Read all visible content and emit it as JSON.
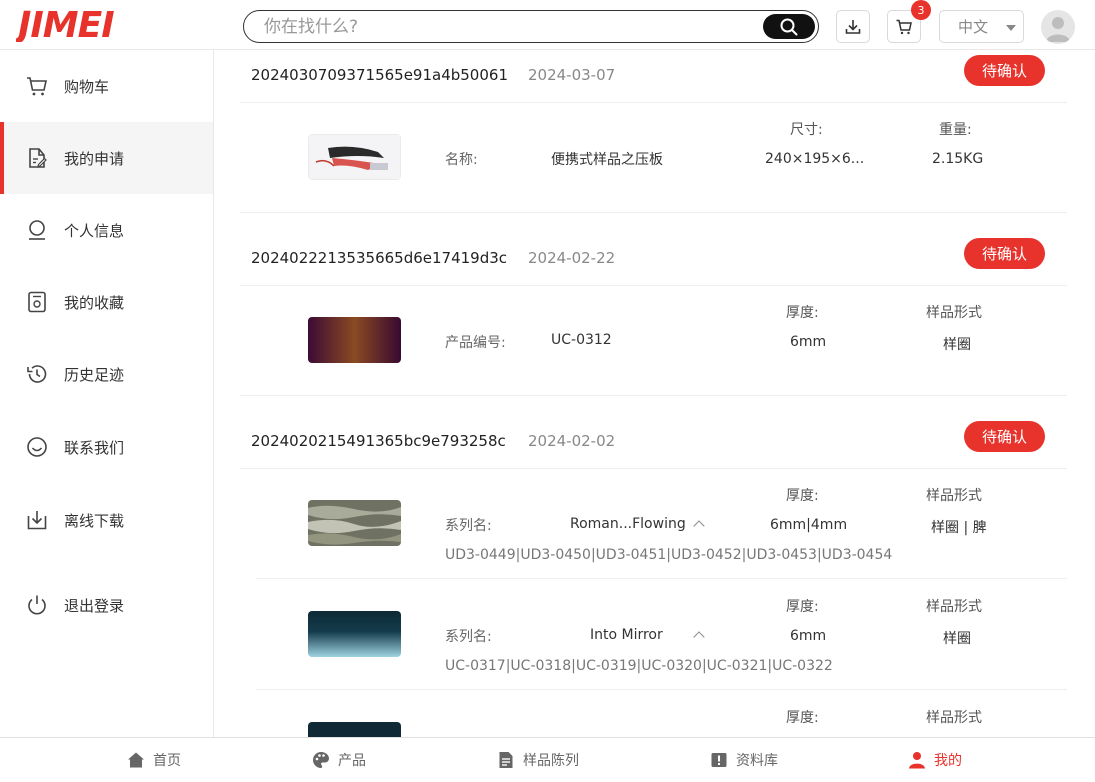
{
  "header": {
    "logo_text": "JIMEI",
    "search_placeholder": "你在找什么?",
    "cart_badge": "3",
    "language": "中文"
  },
  "sidebar": {
    "items": [
      {
        "label": "购物车",
        "icon": "cart-icon"
      },
      {
        "label": "我的申请",
        "icon": "edit-document-icon",
        "active": true
      },
      {
        "label": "个人信息",
        "icon": "user-icon"
      },
      {
        "label": "我的收藏",
        "icon": "favorite-icon"
      },
      {
        "label": "历史足迹",
        "icon": "history-icon"
      },
      {
        "label": "联系我们",
        "icon": "smile-icon"
      },
      {
        "label": "离线下载",
        "icon": "download-icon"
      },
      {
        "label": "退出登录",
        "icon": "power-icon"
      }
    ]
  },
  "orders": [
    {
      "id": "2024030709371565e91a4b50061",
      "date": "2024-03-07",
      "status": "待确认",
      "item": {
        "name_label": "名称:",
        "name_value": "便携式样品之压板",
        "size_label": "尺寸:",
        "size_value": "240×195×6...",
        "weight_label": "重量:",
        "weight_value": "2.15KG"
      }
    },
    {
      "id": "2024022213535665d6e17419d3c",
      "date": "2024-02-22",
      "status": "待确认",
      "item": {
        "code_label": "产品编号:",
        "code_value": "UC-0312",
        "thickness_label": "厚度:",
        "thickness_value": "6mm",
        "form_label": "样品形式",
        "form_value": "样圈"
      }
    },
    {
      "id": "2024020215491365bc9e793258c",
      "date": "2024-02-02",
      "status": "待确认",
      "items": [
        {
          "series_label": "系列名:",
          "series_value": "Roman...Flowing",
          "thickness_label": "厚度:",
          "thickness_value": "6mm|4mm",
          "form_label": "样品形式",
          "form_value": "样圈 | 脾",
          "codes": "UD3-0449|UD3-0450|UD3-0451|UD3-0452|UD3-0453|UD3-0454"
        },
        {
          "series_label": "系列名:",
          "series_value": "Into Mirror",
          "thickness_label": "厚度:",
          "thickness_value": "6mm",
          "form_label": "样品形式",
          "form_value": "样圈",
          "codes": "UC-0317|UC-0318|UC-0319|UC-0320|UC-0321|UC-0322"
        },
        {
          "thickness_label": "厚度:",
          "form_label": "样品形式"
        }
      ]
    }
  ],
  "bottom_nav": [
    {
      "label": "首页",
      "icon": "home-icon"
    },
    {
      "label": "产品",
      "icon": "palette-icon"
    },
    {
      "label": "样品陈列",
      "icon": "document-icon"
    },
    {
      "label": "资料库",
      "icon": "library-icon"
    },
    {
      "label": "我的",
      "icon": "person-icon",
      "active": true
    }
  ],
  "colors": {
    "accent": "#e8332c"
  }
}
